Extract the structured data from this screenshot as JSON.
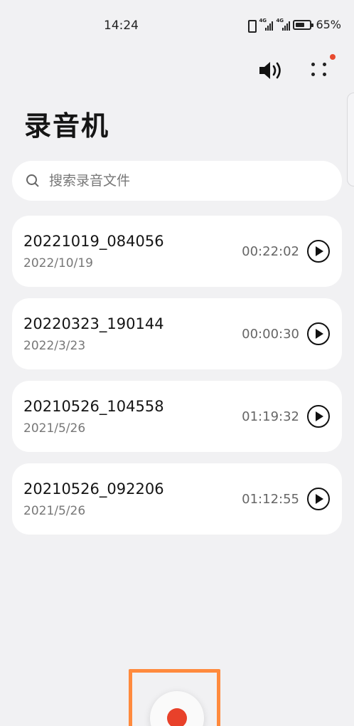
{
  "status_bar": {
    "time": "14:24",
    "network_1": "4G",
    "network_2": "4G",
    "battery_percent": "65%",
    "battery_level": 0.65
  },
  "header": {
    "title": "录音机",
    "speaker_icon": "speaker-icon",
    "more_icon": "more-dots-icon",
    "notification_badge_color": "#e84a2f"
  },
  "search": {
    "placeholder": "搜索录音文件",
    "value": ""
  },
  "recordings": [
    {
      "name": "20221019_084056",
      "date": "2022/10/19",
      "duration": "00:22:02"
    },
    {
      "name": "20220323_190144",
      "date": "2022/3/23",
      "duration": "00:00:30"
    },
    {
      "name": "20210526_104558",
      "date": "2021/5/26",
      "duration": "01:19:32"
    },
    {
      "name": "20210526_092206",
      "date": "2021/5/26",
      "duration": "01:12:55"
    }
  ],
  "record_button": {
    "icon": "record-icon",
    "accent": "#e8412a",
    "highlight_color": "#ff8a3d"
  }
}
